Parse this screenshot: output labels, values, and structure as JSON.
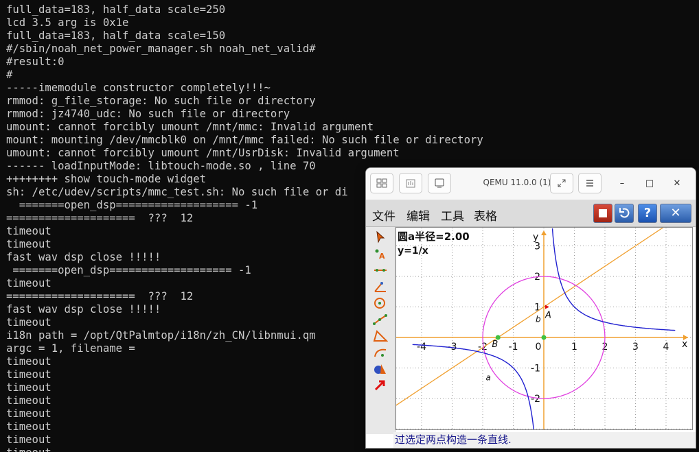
{
  "terminal": {
    "lines": [
      "full_data=183, half_data scale=250",
      "lcd 3.5 arg is 0x1e",
      "full_data=183, half_data scale=150",
      "#/sbin/noah_net_power_manager.sh noah_net_valid#",
      "#result:0",
      "#",
      "-----imemodule constructor completely!!!~",
      "rmmod: g_file_storage: No such file or directory",
      "rmmod: jz4740_udc: No such file or directory",
      "umount: cannot forcibly umount /mnt/mmc: Invalid argument",
      "mount: mounting /dev/mmcblk0 on /mnt/mmc failed: No such file or directory",
      "umount: cannot forcibly umount /mnt/UsrDisk: Invalid argument",
      "------ loadInputMode: libtouch-mode.so , line 70",
      "++++++++ show touch-mode widget",
      "sh: /etc/udev/scripts/mmc_test.sh: No such file or di",
      "  =======open_dsp=================== -1",
      "====================  ???  12",
      "timeout",
      "timeout",
      "fast wav dsp close !!!!!",
      " =======open_dsp=================== -1",
      "timeout",
      "====================  ???  12",
      "fast wav dsp close !!!!!",
      "timeout",
      "i18n path = /opt/QtPalmtop/i18n/zh_CN/libnmui.qm",
      "argc = 1, filename =",
      "timeout",
      "timeout",
      "timeout",
      "timeout",
      "timeout",
      "timeout",
      "timeout",
      "timeout"
    ]
  },
  "qemu": {
    "title": "QEMU 11.0.0 (1)",
    "minimize": "–",
    "maximize": "□",
    "close": "✕",
    "menu": [
      "文件",
      "编辑",
      "工具",
      "表格"
    ],
    "help_label": "?",
    "close_label": "✕",
    "info": {
      "circle_radius": "圆a半径=2.00",
      "function": "y=1/x"
    },
    "axis": {
      "x_label": "x",
      "y_label": "y",
      "x_ticks": [
        "-4",
        "-3",
        "-2",
        "-1",
        "0",
        "1",
        "2",
        "3",
        "4"
      ],
      "y_ticks": [
        "3",
        "2",
        "1",
        "-1",
        "-2"
      ]
    },
    "point_labels": {
      "A": "A",
      "B": "B",
      "a": "a",
      "b": "b"
    },
    "status": "过选定两点构造一条直线."
  },
  "colors": {
    "terminal_bg": "#0c0c0c",
    "terminal_fg": "#cccccc",
    "axis": "#f0a030",
    "grid": "#9a9a9a",
    "circle": "#e040e0",
    "hyperbola": "#2020d0",
    "line": "#f0a030",
    "point": "#40c040"
  },
  "icons": [
    "tile-icon",
    "screenshot-icon",
    "display-icon",
    "fullscreen-icon",
    "menu-icon",
    "select-arrow-icon",
    "point-icon",
    "segment-icon",
    "angle-icon",
    "circle-icon",
    "polyline-icon",
    "polygon-icon",
    "arc-icon",
    "paint-icon",
    "undo-arrow-icon"
  ]
}
